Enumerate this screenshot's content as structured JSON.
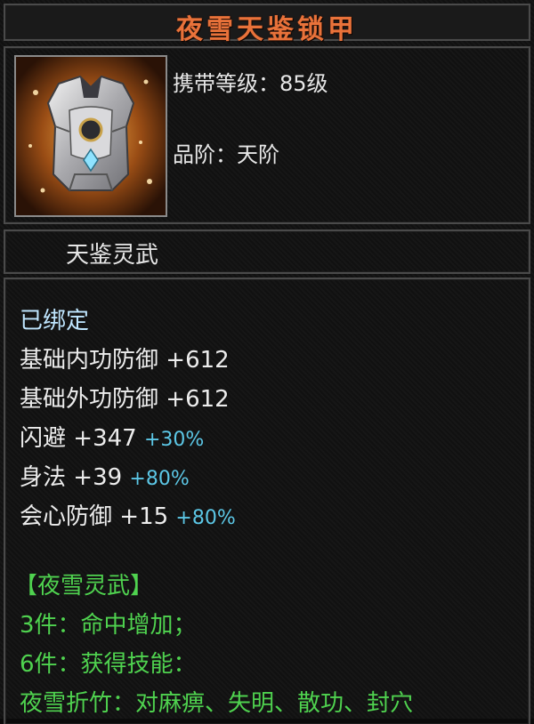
{
  "item": {
    "name": "夜雪天鉴锁甲",
    "icon": "armor-chest-icon",
    "level_label": "携带等级：85级",
    "grade_label": "品阶：天阶",
    "series": "天鉴灵武"
  },
  "attributes": {
    "bound": "已绑定",
    "stats": [
      {
        "name": "基础内功防御",
        "value": "+612",
        "bonus": ""
      },
      {
        "name": "基础外功防御",
        "value": "+612",
        "bonus": ""
      },
      {
        "name": "闪避",
        "value": "+347",
        "bonus": "+30%"
      },
      {
        "name": "身法",
        "value": "+39",
        "bonus": "+80%"
      },
      {
        "name": "会心防御",
        "value": "+15",
        "bonus": "+80%"
      }
    ]
  },
  "set": {
    "title": "【夜雪灵武】",
    "bonus3": "3件：命中增加；",
    "bonus6": "6件：获得技能：",
    "skill": "夜雪折竹：对麻痹、失明、散功、封穴"
  },
  "colors": {
    "title": "#e9723a",
    "text": "#e6e6e6",
    "percent": "#5cc7e6",
    "set": "#4fd24f"
  }
}
